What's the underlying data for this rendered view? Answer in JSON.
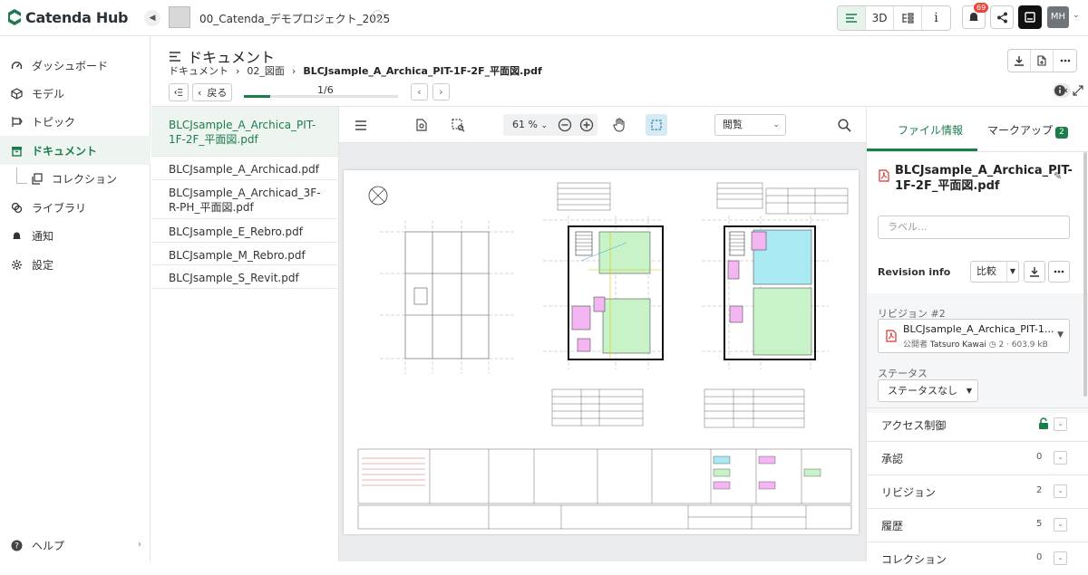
{
  "app": {
    "logo_text": "Catenda Hub",
    "project_name": "00_Catenda_デモプロジェクト_2025",
    "view_3d_label": "3D",
    "info_label": "i",
    "notification_count": "69",
    "user_initials": "MH"
  },
  "sidebar": {
    "items": [
      {
        "label": "ダッシュボード",
        "icon": "gauge-icon"
      },
      {
        "label": "モデル",
        "icon": "cube-icon"
      },
      {
        "label": "トピック",
        "icon": "topic-icon"
      },
      {
        "label": "ドキュメント",
        "icon": "archive-icon"
      },
      {
        "label": "コレクション",
        "icon": "copy-icon"
      },
      {
        "label": "ライブラリ",
        "icon": "library-icon"
      },
      {
        "label": "通知",
        "icon": "bell-icon"
      },
      {
        "label": "設定",
        "icon": "gear-icon"
      }
    ],
    "help_label": "ヘルプ"
  },
  "header": {
    "title": "ドキュメント",
    "breadcrumb": [
      "ドキュメント",
      "02_図面",
      "BLCJsample_A_Archica_PIT-1F-2F_平面図.pdf"
    ],
    "back_label": "戻る",
    "page_indicator": "1/6",
    "progress_fraction": 0.17
  },
  "files": [
    "BLCJsample_A_Archica_PIT-1F-2F_平面図.pdf",
    "BLCJsample_A_Archicad.pdf",
    "BLCJsample_A_Archicad_3F-R-PH_平面図.pdf",
    "BLCJsample_E_Rebro.pdf",
    "BLCJsample_M_Rebro.pdf",
    "BLCJsample_S_Revit.pdf"
  ],
  "viewer": {
    "zoom": "61 %",
    "mode": "閲覧"
  },
  "right_panel": {
    "tab_file_info": "ファイル情報",
    "tab_markup": "マークアップ",
    "markup_count": "2",
    "file_title": "BLCJsample_A_Archica_PIT-1F-2F_平面図.pdf",
    "label_placeholder": "ラベル...",
    "revision_info": "Revision info",
    "compare_label": "比較",
    "revision_label": "リビジョン #2",
    "revision_file": "BLCJsample_A_Archica_PIT-1...",
    "publisher_label": "公開者",
    "publisher_name": "Tatsuro Kawai",
    "revision_meta": "2 · 603.9 kB",
    "status_label": "ステータス",
    "status_value": "ステータスなし",
    "sections": [
      {
        "label": "アクセス制御",
        "count": ""
      },
      {
        "label": "承認",
        "count": "0"
      },
      {
        "label": "リビジョン",
        "count": "2"
      },
      {
        "label": "履歴",
        "count": "5"
      },
      {
        "label": "コレクション",
        "count": "0"
      }
    ]
  },
  "colors": {
    "accent": "#1c7c4a",
    "badge": "#e8453c",
    "pdf_red": "#d9342b"
  }
}
